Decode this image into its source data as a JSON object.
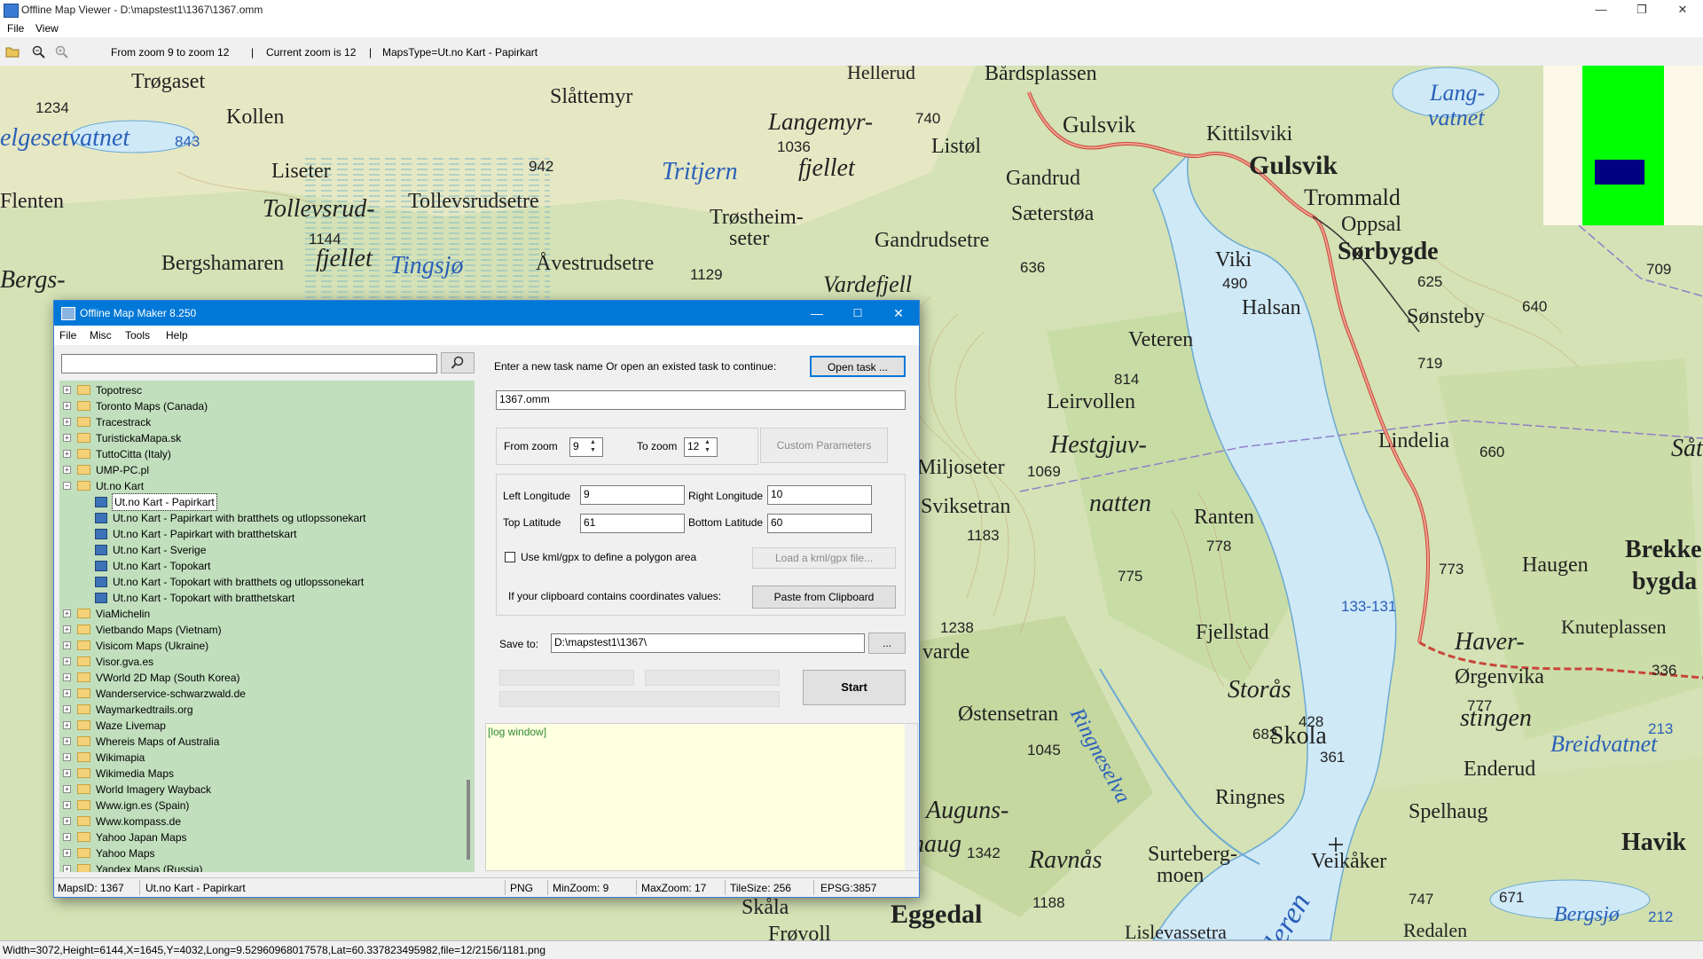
{
  "window": {
    "title": "Offline Map Viewer - D:\\mapstest1\\1367\\1367.omm",
    "minimize": "—",
    "maximize": "❐",
    "close": "✕"
  },
  "menubar": {
    "file": "File",
    "view": "View"
  },
  "toolbar": {
    "zoom_range": "From zoom 9 to zoom 12",
    "current_zoom": "Current zoom is 12",
    "maps_type": "MapsType=Ut.no Kart - Papirkart",
    "sep": "|"
  },
  "statusbar": {
    "text": "Width=3072,Height=6144,X=1645,Y=4032,Long=9.52960968017578,Lat=60.337823495982,file=12/2156/1181.png"
  },
  "map": {
    "labels": [
      "Hellerud",
      "Bårdsplassen",
      "Trøgaset",
      "Slåttemyr",
      "Lang-",
      "vatnet",
      "1234",
      "Kollen",
      "Langemyr-",
      "740",
      "Gulsvik",
      "Kittilsviki",
      "elgesetvatnet",
      "843",
      "1036",
      "Listøl",
      "fjellet",
      "Gulsvik",
      "942",
      "Tritjern",
      "Gandrud",
      "Trommald",
      "Liseter",
      "Flenten",
      "Tollevsrud-",
      "Tollevsrudsetre",
      "Trøstheim-",
      "Sæterstøa",
      "Oppsal",
      "seter",
      "Sørbygde",
      "1144",
      "fjellet",
      "Gandrudsetre",
      "Viki",
      "625",
      "709",
      "Bergs-",
      "Bergshamaren",
      "fjellet",
      "Tingsjø",
      "Åvestrudsetre",
      "1129",
      "636",
      "Vardefjell",
      "490",
      "Halsan",
      "Sønsteby",
      "640",
      "Veteren",
      "719",
      "814",
      "Leirvollen",
      "Lindelia",
      "660",
      "Såt",
      "Hestgjuv-",
      "1069",
      "Miljoseter",
      "natten",
      "Ranten",
      "Sviksetran",
      "1183",
      "778",
      "Brekke",
      "bygda",
      "775",
      "773",
      "Haugen",
      "133-131",
      "1238",
      "Fjellstad",
      "Knuteplassen",
      "Haver-",
      "varde",
      "336",
      "Ringneselva",
      "Storås",
      "Ørgenvika",
      "777",
      "stingen",
      "213",
      "Østensetran",
      "428",
      "682",
      "Skola",
      "Breidvatnet",
      "1045",
      "361",
      "Enderud",
      "Auguns-",
      "Ringnes",
      "haug",
      "Spelhaug",
      "1342",
      "Surteberg-",
      "Ravnås",
      "moen",
      "Havik",
      "Veikåker",
      "Skåla",
      "1188",
      "747",
      "671",
      "Bergsjø",
      "212",
      "Frøvoll",
      "Eggedal",
      "Lislevassetra",
      "Redalen",
      "deren"
    ]
  },
  "dialog": {
    "title": "Offline Map Maker 8.250",
    "menu": [
      "File",
      "Misc",
      "Tools",
      "Help"
    ],
    "search_value": "",
    "tree": [
      {
        "label": "Topotresc",
        "type": "folder",
        "expander": "+"
      },
      {
        "label": "Toronto Maps (Canada)",
        "type": "folder",
        "expander": "+"
      },
      {
        "label": "Tracestrack",
        "type": "folder",
        "expander": "+"
      },
      {
        "label": "TuristickaMapa.sk",
        "type": "folder",
        "expander": "+"
      },
      {
        "label": "TuttoCitta (Italy)",
        "type": "folder",
        "expander": "+"
      },
      {
        "label": "UMP-PC.pl",
        "type": "folder",
        "expander": "+"
      },
      {
        "label": "Ut.no Kart",
        "type": "folder-open",
        "expander": "−"
      },
      {
        "label": "Ut.no Kart - Papirkart",
        "type": "map",
        "selected": true
      },
      {
        "label": "Ut.no Kart - Papirkart with bratthets og utlopssonekart",
        "type": "map"
      },
      {
        "label": "Ut.no Kart - Papirkart with bratthetskart",
        "type": "map"
      },
      {
        "label": "Ut.no Kart - Sverige",
        "type": "map"
      },
      {
        "label": "Ut.no Kart - Topokart",
        "type": "map"
      },
      {
        "label": "Ut.no Kart - Topokart with bratthets og utlopssonekart",
        "type": "map"
      },
      {
        "label": "Ut.no Kart - Topokart with bratthetskart",
        "type": "map"
      },
      {
        "label": "ViaMichelin",
        "type": "folder",
        "expander": "+"
      },
      {
        "label": "Vietbando Maps (Vietnam)",
        "type": "folder",
        "expander": "+"
      },
      {
        "label": "Visicom Maps (Ukraine)",
        "type": "folder",
        "expander": "+"
      },
      {
        "label": "Visor.gva.es",
        "type": "folder",
        "expander": "+"
      },
      {
        "label": "VWorld 2D Map (South Korea)",
        "type": "folder",
        "expander": "+"
      },
      {
        "label": "Wanderservice-schwarzwald.de",
        "type": "folder",
        "expander": "+"
      },
      {
        "label": "Waymarkedtrails.org",
        "type": "folder",
        "expander": "+"
      },
      {
        "label": "Waze Livemap",
        "type": "folder",
        "expander": "+"
      },
      {
        "label": "Whereis Maps of Australia",
        "type": "folder",
        "expander": "+"
      },
      {
        "label": "Wikimapia",
        "type": "folder",
        "expander": "+"
      },
      {
        "label": "Wikimedia Maps",
        "type": "folder",
        "expander": "+"
      },
      {
        "label": "World Imagery Wayback",
        "type": "folder",
        "expander": "+"
      },
      {
        "label": "Www.ign.es (Spain)",
        "type": "folder",
        "expander": "+"
      },
      {
        "label": "Www.kompass.de",
        "type": "folder",
        "expander": "+"
      },
      {
        "label": "Yahoo Japan Maps",
        "type": "folder",
        "expander": "+"
      },
      {
        "label": "Yahoo Maps",
        "type": "folder",
        "expander": "+"
      },
      {
        "label": "Yandex Maps (Russia)",
        "type": "folder",
        "expander": "+"
      }
    ],
    "task_prompt": "Enter a new task name Or open an existed task to continue:",
    "open_task": "Open task ...",
    "task_name": "1367.omm",
    "from_zoom_label": "From zoom",
    "from_zoom": "9",
    "to_zoom_label": "To zoom",
    "to_zoom": "12",
    "custom_params": "Custom Parameters",
    "left_lon_label": "Left Longitude",
    "left_lon": "9",
    "right_lon_label": "Right Longitude",
    "right_lon": "10",
    "top_lat_label": "Top Latitude",
    "top_lat": "61",
    "bottom_lat_label": "Bottom Latitude",
    "bottom_lat": "60",
    "kml_label": "Use kml/gpx to define a polygon area",
    "kml_checked": false,
    "load_kml": "Load a kml/gpx file...",
    "clipboard_label": "If your clipboard contains coordinates values:",
    "paste_clipboard": "Paste from Clipboard",
    "save_to_label": "Save to:",
    "save_to": "D:\\mapstest1\\1367\\",
    "browse": "...",
    "start": "Start",
    "log": "[log window]",
    "status": {
      "maps_id": "MapsID: 1367",
      "map_name": "Ut.no Kart - Papirkart",
      "format": "PNG",
      "min_zoom": "MinZoom: 9",
      "max_zoom": "MaxZoom: 17",
      "tile_size": "TileSize: 256",
      "epsg": "EPSG:3857"
    }
  },
  "colors": {
    "dialog_title_bg": "#0078d7",
    "tree_bg": "#c1dfbd",
    "log_bg": "#ffffe1",
    "minimap_green": "#00ff00",
    "minimap_view": "#000080",
    "water": "#cfe9f7"
  }
}
